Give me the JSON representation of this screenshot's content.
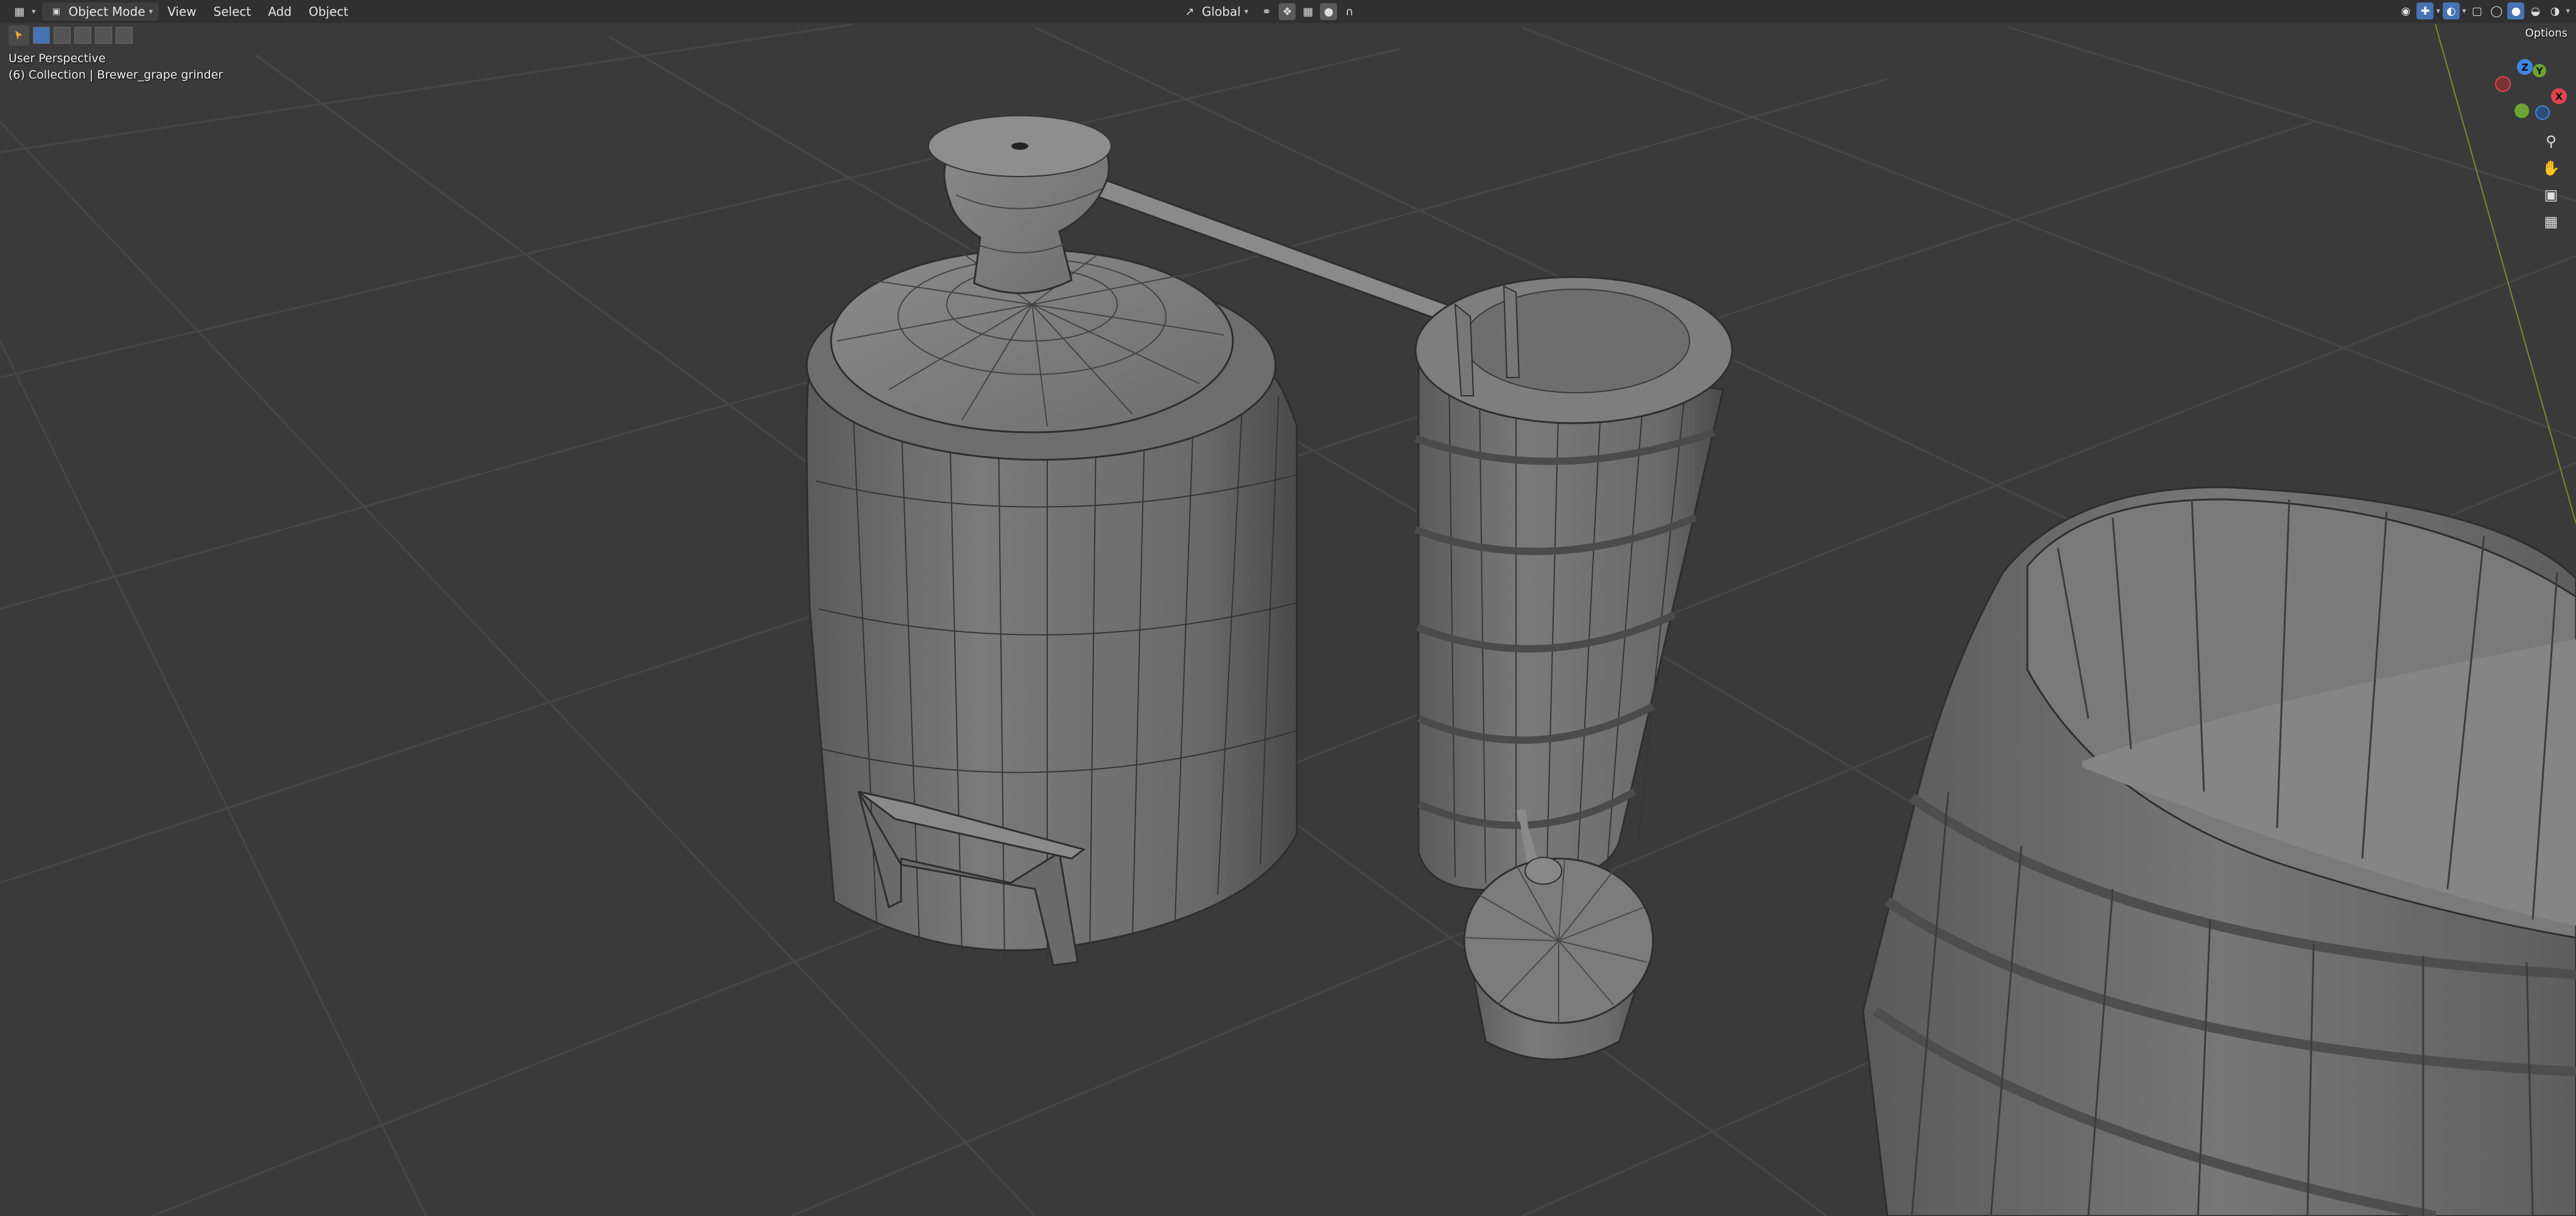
{
  "header": {
    "editor_type_icon": "3d-viewport-icon",
    "mode_label": "Object Mode",
    "menu": [
      "View",
      "Select",
      "Add",
      "Object"
    ],
    "transform_orientation": "Global",
    "options_label": "Options"
  },
  "viewport": {
    "perspective_label": "User Perspective",
    "collection_label": "(6) Collection | Brewer_grape grinder",
    "background_color": "#3a3a3a",
    "grid_color": "#454545"
  },
  "gizmo": {
    "x_label": "X",
    "y_label": "Y",
    "z_label": "Z",
    "x_color": "#e1454d",
    "y_color": "#6ba634",
    "z_color": "#3f86e0"
  },
  "nav_icons": [
    "zoom-icon",
    "pan-hand-icon",
    "camera-icon",
    "orthographic-grid-icon"
  ],
  "scene_objects": [
    "still-boiler",
    "still-head-with-pipe",
    "condenser-barrel",
    "collection-bucket",
    "large-tub"
  ]
}
